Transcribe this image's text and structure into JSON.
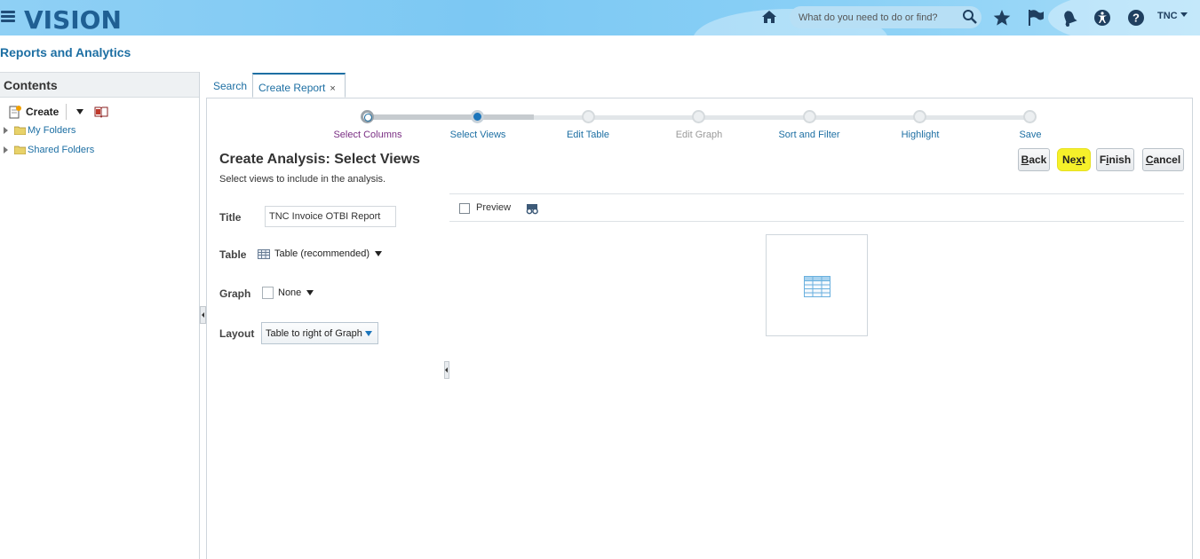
{
  "header": {
    "logo": "VISION",
    "search_placeholder": "What do you need to do or find?",
    "user": "TNC",
    "icons": [
      "menu-icon",
      "home-icon",
      "search-icon",
      "star-icon",
      "flag-icon",
      "bell-icon",
      "accessibility-icon",
      "help-icon"
    ]
  },
  "app": {
    "title": "Reports and Analytics"
  },
  "sidebar": {
    "heading": "Contents",
    "create_label": "Create",
    "folders": [
      {
        "label": "My Folders"
      },
      {
        "label": "Shared Folders"
      }
    ]
  },
  "tabs": [
    {
      "label": "Search",
      "active": false
    },
    {
      "label": "Create Report",
      "active": true,
      "close": "×"
    }
  ],
  "train": {
    "steps": [
      {
        "label": "Select Columns",
        "state": "visited"
      },
      {
        "label": "Select Views",
        "state": "current"
      },
      {
        "label": "Edit Table",
        "state": "future"
      },
      {
        "label": "Edit Graph",
        "state": "disabled"
      },
      {
        "label": "Sort and Filter",
        "state": "future"
      },
      {
        "label": "Highlight",
        "state": "future"
      },
      {
        "label": "Save",
        "state": "future"
      }
    ]
  },
  "page": {
    "heading": "Create Analysis: Select Views",
    "subtitle": "Select views to include in the analysis."
  },
  "buttons": {
    "back": {
      "label": "Back",
      "access_key": "B",
      "rest": "ack"
    },
    "next": {
      "label": "Next",
      "pre": "Ne",
      "access_key": "x",
      "rest": "t"
    },
    "finish": {
      "label": "Finish",
      "pre": "F",
      "access_key": "i",
      "rest": "nish"
    },
    "cancel": {
      "label": "Cancel",
      "access_key": "C",
      "rest": "ancel"
    }
  },
  "form": {
    "title_label": "Title",
    "title_value": "TNC Invoice OTBI Report",
    "table_label": "Table",
    "table_value": "Table (recommended)",
    "graph_label": "Graph",
    "graph_value": "None",
    "layout_label": "Layout",
    "layout_value": "Table to right of Graph"
  },
  "preview": {
    "label": "Preview",
    "checked": false
  },
  "colors": {
    "header_bg": "#7cc8f3",
    "link": "#1d6fa3",
    "current_step": "#1b75bb",
    "next_highlight": "#f6f12a"
  }
}
